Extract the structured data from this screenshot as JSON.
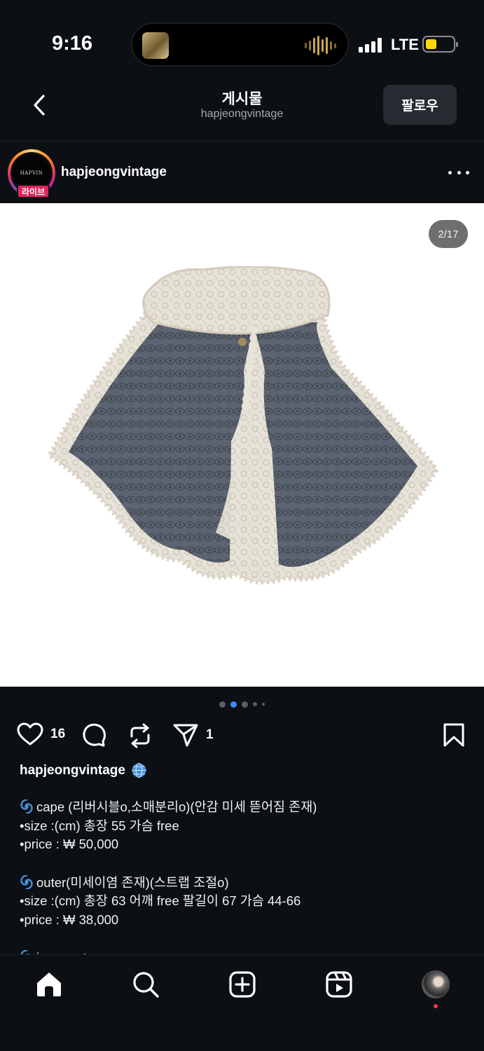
{
  "status_bar": {
    "time": "9:16",
    "network": "LTE",
    "battery_level": 0.4
  },
  "header": {
    "title": "게시물",
    "subtitle": "hapjeongvintage",
    "follow_label": "팔로우"
  },
  "post": {
    "author": "hapjeongvintage",
    "avatar_text": "HAPVIN",
    "live_badge": "라이브",
    "page_counter": "2/17",
    "carousel": {
      "total_visible_dots": 5,
      "active_index": 1
    }
  },
  "actions": {
    "likes": "16",
    "shares": "1"
  },
  "caption": {
    "username": "hapjeongvintage",
    "items": [
      {
        "title": "cape (리버시블o,소매분리o)(안감 미세 뜯어짐 존재)",
        "size": "•size :(cm) 총장 55 가슴 free",
        "price": "•price : ₩ 50,000"
      },
      {
        "title": "outer(미세이염 존재)(스트랩 조절o)",
        "size": "•size :(cm) 총장 63 어깨 free 팔길이 67 가슴 44-66",
        "price": "•price : ₩ 38,000"
      }
    ],
    "truncated_line": "inner outer"
  },
  "colors": {
    "background": "#0c1014",
    "accent_blue": "#3d8bff",
    "live_red": "#e4235a",
    "battery_yellow": "#ffd60a"
  },
  "icons": {
    "nav": [
      "home-icon",
      "search-icon",
      "create-icon",
      "reels-icon",
      "profile-avatar"
    ],
    "actions": [
      "heart-icon",
      "comment-icon",
      "repost-icon",
      "send-icon",
      "bookmark-icon"
    ]
  }
}
